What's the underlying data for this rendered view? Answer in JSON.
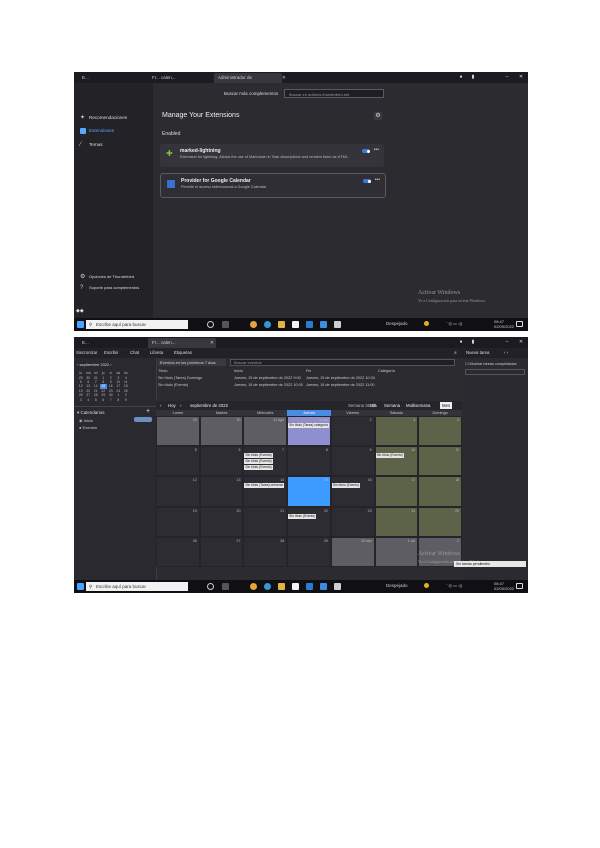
{
  "screenshot1": {
    "tabs": [
      "E...",
      "Fr... calen...",
      "Administrador de complementos",
      "+"
    ],
    "search_label": "Buscar más complementos",
    "search_placeholder": "Buscar en addons.thunderbird.net",
    "sidebar": [
      {
        "label": "Recomendaciones",
        "icon": "sparkle-icon"
      },
      {
        "label": "Extensiones",
        "icon": "puzzle-icon"
      },
      {
        "label": "Temas",
        "icon": "brush-icon"
      }
    ],
    "sidebar_footer": [
      "Opciones de Thunderbird",
      "Soporte para complementos"
    ],
    "page_title": "Manage Your Extensions",
    "section": "Enabled",
    "extensions": [
      {
        "name": "marked-lightning",
        "desc": "Extension for lightning. Allows the use of Markdown in Task descriptions and renders them as HTML."
      },
      {
        "name": "Provider for Google Calendar",
        "desc": "Permite el acceso bidireccional a Google Calendar"
      }
    ],
    "activate": {
      "title": "Activar Windows",
      "sub": "Ve a Configuración para activar Windows."
    }
  },
  "screenshot2": {
    "tabs": [
      "E...",
      "Fr... calen..."
    ],
    "toolbar": [
      "Sincronizar",
      "Escribir",
      "Chat",
      "Libreta",
      "Etiquetas"
    ],
    "search_placeholder": "Eventos en los próximos 7 días",
    "search_field": "Buscar eventos",
    "mini_month": "septiembre 2022",
    "mini_days": [
      "lu",
      "ma",
      "mi",
      "ju",
      "vi",
      "sá",
      "do"
    ],
    "mini_weeks": [
      [
        "29",
        "30",
        "31",
        "1",
        "2",
        "3",
        "4"
      ],
      [
        "5",
        "6",
        "7",
        "8",
        "9",
        "10",
        "11"
      ],
      [
        "12",
        "13",
        "14",
        "15",
        "16",
        "17",
        "18"
      ],
      [
        "19",
        "20",
        "21",
        "22",
        "23",
        "24",
        "25"
      ],
      [
        "26",
        "27",
        "28",
        "29",
        "30",
        "1",
        "2"
      ],
      [
        "3",
        "4",
        "5",
        "6",
        "7",
        "8",
        "9"
      ]
    ],
    "calendars_label": "Calendarios",
    "calendars": [
      "Inicio",
      "Eventos"
    ],
    "list_headers": [
      "Título",
      "Inicio",
      "Fin",
      "Categoría"
    ],
    "list_rows": [
      [
        "Sin título (Tarea) Domingo",
        "Jueves, 15 de septiembre de 2022 9:00",
        "Jueves, 15 de septiembre de 2022 10:00",
        ""
      ],
      [
        "Sin título (Evento)",
        "Jueves, 15 de septiembre de 2022 10:00",
        "Jueves, 15 de septiembre de 2022 11:00",
        ""
      ]
    ],
    "nav_today": "Hoy",
    "nav_month": "septiembre de 2022",
    "nav_week": "Semana 36-40",
    "views": [
      "Día",
      "Semana",
      "Multisemana",
      "Mes"
    ],
    "active_view": "Mes",
    "weekdays": [
      "Lunes",
      "Martes",
      "Miércoles",
      "Jueves",
      "Viernes",
      "Sábado",
      "Domingo"
    ],
    "weeks": [
      [
        "29",
        "30",
        "31 ago",
        "1 sep",
        "2",
        "3",
        "4"
      ],
      [
        "5",
        "6",
        "7",
        "8",
        "9",
        "10",
        "11"
      ],
      [
        "12",
        "13",
        "14",
        "15",
        "16",
        "17",
        "18"
      ],
      [
        "19",
        "20",
        "21",
        "22",
        "23",
        "24",
        "25"
      ],
      [
        "26",
        "27",
        "28",
        "29",
        "30 sep",
        "1 oct",
        "2"
      ]
    ],
    "events": [
      {
        "w": 0,
        "d": 3,
        "text": "Sin título (Tarea) categoria"
      },
      {
        "w": 1,
        "d": 2,
        "text": "Sin título (Evento)"
      },
      {
        "w": 1,
        "d": 2,
        "text": "Sin título (Evento)"
      },
      {
        "w": 1,
        "d": 2,
        "text": "Sin título (Evento)"
      },
      {
        "w": 1,
        "d": 5,
        "text": "Sin título (Evento)"
      },
      {
        "w": 2,
        "d": 2,
        "text": "Sin título (Tarea) ontoerar"
      },
      {
        "w": 2,
        "d": 4,
        "text": "Sin título (Evento)"
      },
      {
        "w": 3,
        "d": 3,
        "text": "Sin título (Evento)"
      }
    ],
    "rpane_filter": "Mostrar tareas completadas",
    "rpane_new": "Nueva tarea",
    "activate": {
      "title": "Activar Windows",
      "sub": "Ve a Configuración para activar Windows."
    },
    "status": "Sin tareas pendientes"
  },
  "taskbar": {
    "search": "Escribe aquí para buscar",
    "weather": "Despejado",
    "time": "08:47",
    "date": "02/09/2022"
  }
}
